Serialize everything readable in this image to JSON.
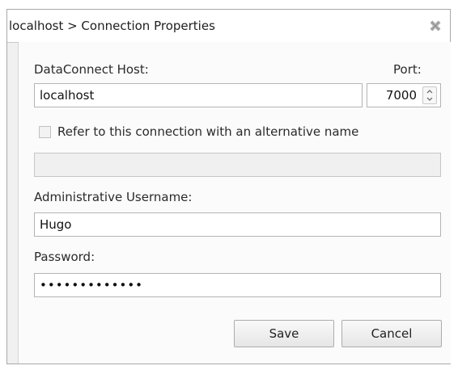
{
  "window": {
    "title": "localhost > Connection Properties",
    "close_icon": "close-x-icon"
  },
  "form": {
    "host": {
      "label": "DataConnect Host:",
      "value": "localhost"
    },
    "port": {
      "label": "Port:",
      "value": "7000",
      "spinner_icons": [
        "chevron-up-icon",
        "chevron-down-icon"
      ]
    },
    "alt_name": {
      "checkbox_label": "Refer to this connection with an alternative name",
      "checked": false,
      "value": ""
    },
    "username": {
      "label": "Administrative Username:",
      "value": "Hugo"
    },
    "password": {
      "label": "Password:",
      "value": "•••••••••••••"
    }
  },
  "buttons": {
    "save": "Save",
    "cancel": "Cancel"
  },
  "colors": {
    "window_bg": "#f0f0f0",
    "panel_bg": "#fbfbfb",
    "border": "#b4b4b4"
  }
}
